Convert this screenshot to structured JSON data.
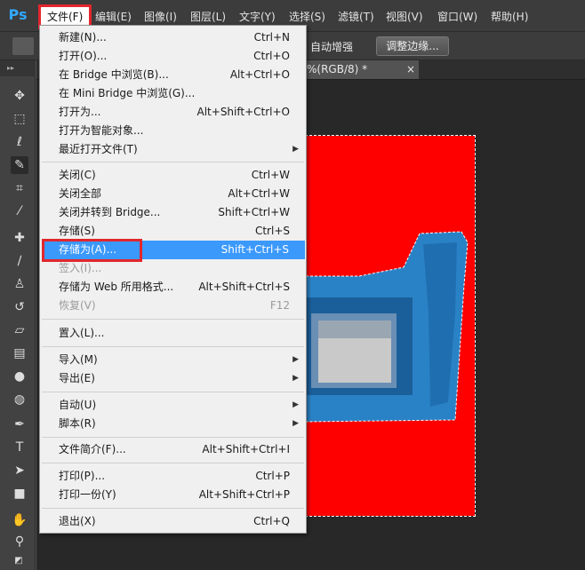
{
  "app": {
    "logo": "Ps"
  },
  "menubar": {
    "items": [
      "文件(F)",
      "编辑(E)",
      "图像(I)",
      "图层(L)",
      "文字(Y)",
      "选择(S)",
      "滤镜(T)",
      "视图(V)",
      "窗口(W)",
      "帮助(H)"
    ],
    "active_index": 0
  },
  "optionsbar": {
    "auto_enhance": "自动增强",
    "refine_edge": "调整边缘..."
  },
  "document": {
    "tab_title": "%(RGB/8) *",
    "tab_close": "×",
    "canvas_color": "#ff0000"
  },
  "file_menu": {
    "items": [
      {
        "label": "新建(N)...",
        "shortcut": "Ctrl+N"
      },
      {
        "label": "打开(O)...",
        "shortcut": "Ctrl+O"
      },
      {
        "label": "在 Bridge 中浏览(B)...",
        "shortcut": "Alt+Ctrl+O"
      },
      {
        "label": "在 Mini Bridge 中浏览(G)...",
        "shortcut": ""
      },
      {
        "label": "打开为...",
        "shortcut": "Alt+Shift+Ctrl+O"
      },
      {
        "label": "打开为智能对象...",
        "shortcut": ""
      },
      {
        "label": "最近打开文件(T)",
        "shortcut": "",
        "submenu": true
      },
      {
        "label": "关闭(C)",
        "shortcut": "Ctrl+W"
      },
      {
        "label": "关闭全部",
        "shortcut": "Alt+Ctrl+W"
      },
      {
        "label": "关闭并转到 Bridge...",
        "shortcut": "Shift+Ctrl+W"
      },
      {
        "label": "存储(S)",
        "shortcut": "Ctrl+S"
      },
      {
        "label": "存储为(A)...",
        "shortcut": "Shift+Ctrl+S",
        "highlighted": true
      },
      {
        "label": "签入(I)...",
        "shortcut": "",
        "disabled": true
      },
      {
        "label": "存储为 Web 所用格式...",
        "shortcut": "Alt+Shift+Ctrl+S"
      },
      {
        "label": "恢复(V)",
        "shortcut": "F12",
        "disabled": true
      },
      {
        "label": "置入(L)...",
        "shortcut": ""
      },
      {
        "label": "导入(M)",
        "shortcut": "",
        "submenu": true
      },
      {
        "label": "导出(E)",
        "shortcut": "",
        "submenu": true
      },
      {
        "label": "自动(U)",
        "shortcut": "",
        "submenu": true
      },
      {
        "label": "脚本(R)",
        "shortcut": "",
        "submenu": true
      },
      {
        "label": "文件简介(F)...",
        "shortcut": "Alt+Shift+Ctrl+I"
      },
      {
        "label": "打印(P)...",
        "shortcut": "Ctrl+P"
      },
      {
        "label": "打印一份(Y)",
        "shortcut": "Alt+Shift+Ctrl+P"
      },
      {
        "label": "退出(X)",
        "shortcut": "Ctrl+Q"
      }
    ]
  },
  "tools": [
    "move-icon",
    "marquee-icon",
    "lasso-icon",
    "quick-selection-icon",
    "crop-icon",
    "eyedropper-icon",
    "healing-brush-icon",
    "brush-icon",
    "clone-stamp-icon",
    "history-brush-icon",
    "eraser-icon",
    "gradient-icon",
    "blur-icon",
    "dodge-icon",
    "pen-icon",
    "type-icon",
    "path-selection-icon",
    "rectangle-icon",
    "hand-icon",
    "zoom-icon"
  ],
  "colors": {
    "highlight": "#3b99fc",
    "annotation_red": "#e3262d",
    "ps_blue": "#31a8ff"
  }
}
